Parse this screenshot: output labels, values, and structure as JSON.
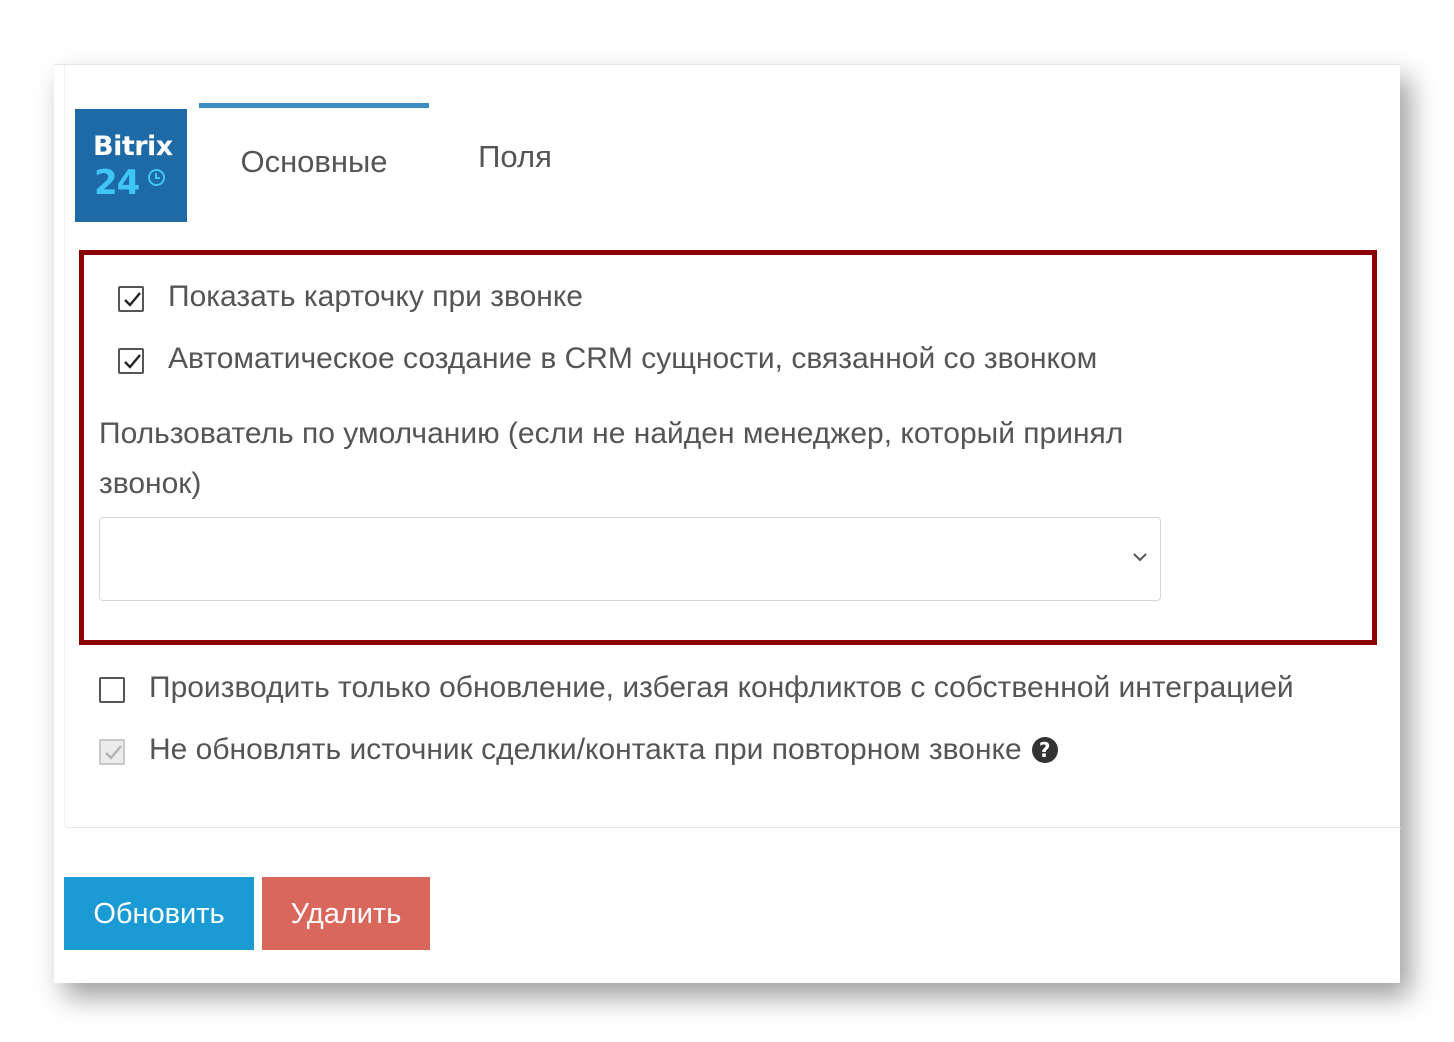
{
  "logo": {
    "line1": "Bitrix",
    "line2": "24"
  },
  "tabs": [
    {
      "label": "Основные",
      "active": true
    },
    {
      "label": "Поля",
      "active": false
    }
  ],
  "options": {
    "show_card": {
      "label": "Показать карточку при звонке",
      "checked": true
    },
    "auto_create": {
      "label": "Автоматическое создание в CRM сущности, связанной со звонком",
      "checked": true
    },
    "update_only": {
      "label": "Производить только обновление, избегая конфликтов с собственной интеграцией",
      "checked": false
    },
    "no_update_source": {
      "label": "Не обновлять источник сделки/контакта при повторном звонке",
      "checked": true,
      "disabled": true
    }
  },
  "default_user": {
    "label": "Пользователь по умолчанию (если не найден менеджер, который принял звонок)",
    "value": ""
  },
  "buttons": {
    "update": "Обновить",
    "delete": "Удалить"
  },
  "colors": {
    "highlight_border": "#8b0000",
    "update_button": "#1a9bd3",
    "delete_button": "#d9675c",
    "logo_background": "#1e6aa6",
    "active_tab_accent": "#3c8dc5"
  }
}
